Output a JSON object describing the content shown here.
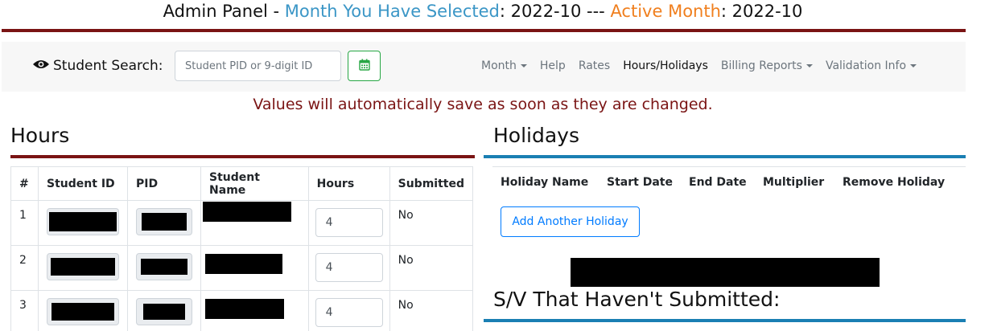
{
  "header": {
    "prefix": "Admin Panel - ",
    "selected_label": "Month You Have Selected",
    "selected_value": ": 2022-10 --- ",
    "active_label": "Active Month",
    "active_value": ": 2022-10"
  },
  "search": {
    "label": "Student Search:",
    "placeholder": "Student PID or 9-digit ID"
  },
  "nav": {
    "month": "Month",
    "help": "Help",
    "rates": "Rates",
    "hours_holidays": "Hours/Holidays",
    "billing": "Billing Reports",
    "validation": "Validation Info"
  },
  "notice": "Values will automatically save as soon as they are changed.",
  "hours": {
    "title": "Hours",
    "columns": [
      "#",
      "Student ID",
      "PID",
      "Student Name",
      "Hours",
      "Submitted"
    ],
    "rows": [
      {
        "num": "1",
        "hours": "4",
        "submitted": "No"
      },
      {
        "num": "2",
        "hours": "4",
        "submitted": "No"
      },
      {
        "num": "3",
        "hours": "4",
        "submitted": "No"
      }
    ]
  },
  "holidays": {
    "title": "Holidays",
    "columns": [
      "Holiday Name",
      "Start Date",
      "End Date",
      "Multiplier",
      "Remove Holiday"
    ],
    "add_button": "Add Another Holiday"
  },
  "sv_title": "S/V That Haven't Submitted:",
  "colors": {
    "rule_dark": "#7a1414",
    "rule_blue": "#1a7fb3",
    "selected_blue": "#3b96c6",
    "active_orange": "#f07f1e"
  }
}
